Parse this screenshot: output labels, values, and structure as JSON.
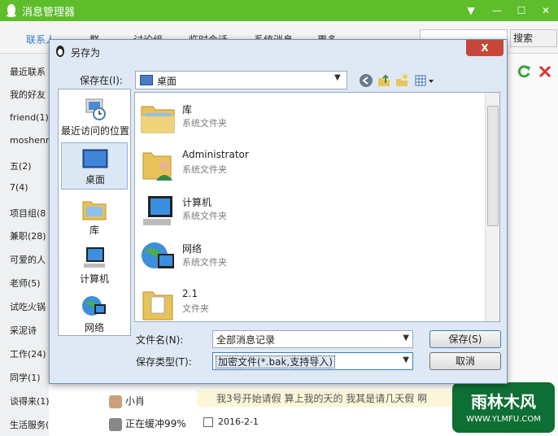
{
  "app": {
    "title": "消息管理器",
    "controls": {
      "dropdown": "▼",
      "minimize": "—",
      "maximize": "☐",
      "close": "✕"
    }
  },
  "tabs": [
    "联系人",
    "群",
    "讨论组",
    "临时会话",
    "系统消息",
    "更多"
  ],
  "search": {
    "button_label": "搜索"
  },
  "sidebar": {
    "items": [
      "最近联系",
      "我的好友",
      "friend(1)",
      "moshenre",
      "五(2)",
      "7(4)",
      "项目组(8",
      "兼职(28)",
      "可爱的人",
      "老师(5)",
      "试吃火锅",
      "采泥诗",
      "工作(24)",
      "同学(1)",
      "谈得来(1)",
      "生活服务(3"
    ]
  },
  "contacts": [
    {
      "name": "小肖"
    },
    {
      "name": "正在缓冲99%"
    }
  ],
  "message": {
    "text": "我3号开始请假 算上我的天的 我其是请几天假 啊",
    "date": "2016-2-1"
  },
  "watermark": {
    "brand": "雨林木风",
    "url": "WWW.YLMFU.COM"
  },
  "dialog": {
    "title": "另存为",
    "close_label": "X",
    "save_in_label": "保存在(I):",
    "location": "桌面",
    "places": [
      {
        "label": "最近访问的位置",
        "icon": "recent-icon"
      },
      {
        "label": "桌面",
        "icon": "desktop-icon"
      },
      {
        "label": "库",
        "icon": "library-icon"
      },
      {
        "label": "计算机",
        "icon": "computer-icon"
      },
      {
        "label": "网络",
        "icon": "network-icon"
      }
    ],
    "files": [
      {
        "name": "库",
        "type": "系统文件夹",
        "icon": "library-folder-icon"
      },
      {
        "name": "Administrator",
        "type": "系统文件夹",
        "icon": "user-folder-icon"
      },
      {
        "name": "计算机",
        "type": "系统文件夹",
        "icon": "computer-icon"
      },
      {
        "name": "网络",
        "type": "系统文件夹",
        "icon": "network-icon"
      },
      {
        "name": "2.1",
        "type": "文件夹",
        "icon": "folder-icon"
      }
    ],
    "filename_label": "文件名(N):",
    "filename_value": "全部消息记录",
    "filetype_label": "保存类型(T):",
    "filetype_value": "加密文件(*.bak,支持导入)",
    "save_button": "保存(S)",
    "cancel_button": "取消"
  }
}
